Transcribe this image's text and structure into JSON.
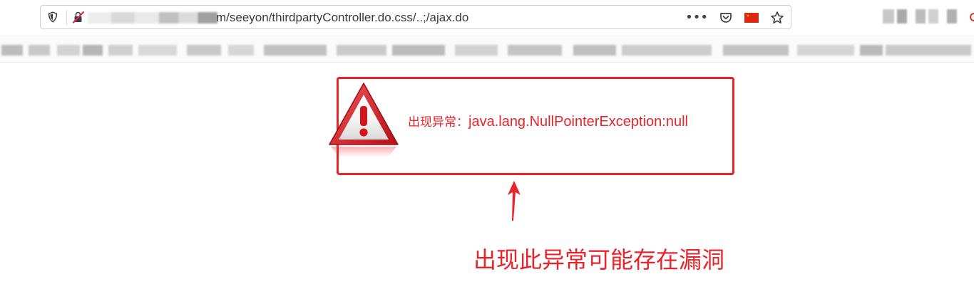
{
  "browser": {
    "url_visible": "m/seeyon/thirdpartyController.do.css/..;/ajax.do",
    "menu_label": "•••",
    "icons": {
      "shield": "shield-icon",
      "insecure": "insecure-lock-icon",
      "pocket": "pocket-icon",
      "flag": "china-flag-icon",
      "bookmark": "star-icon"
    }
  },
  "error": {
    "prefix": "出现异常：",
    "message": "java.lang.NullPointerException:null",
    "icon": "warning-icon"
  },
  "annotation": {
    "text": "出现此异常可能存在漏洞",
    "color": "#e8242a"
  },
  "colors": {
    "accent": "#e8242a"
  }
}
